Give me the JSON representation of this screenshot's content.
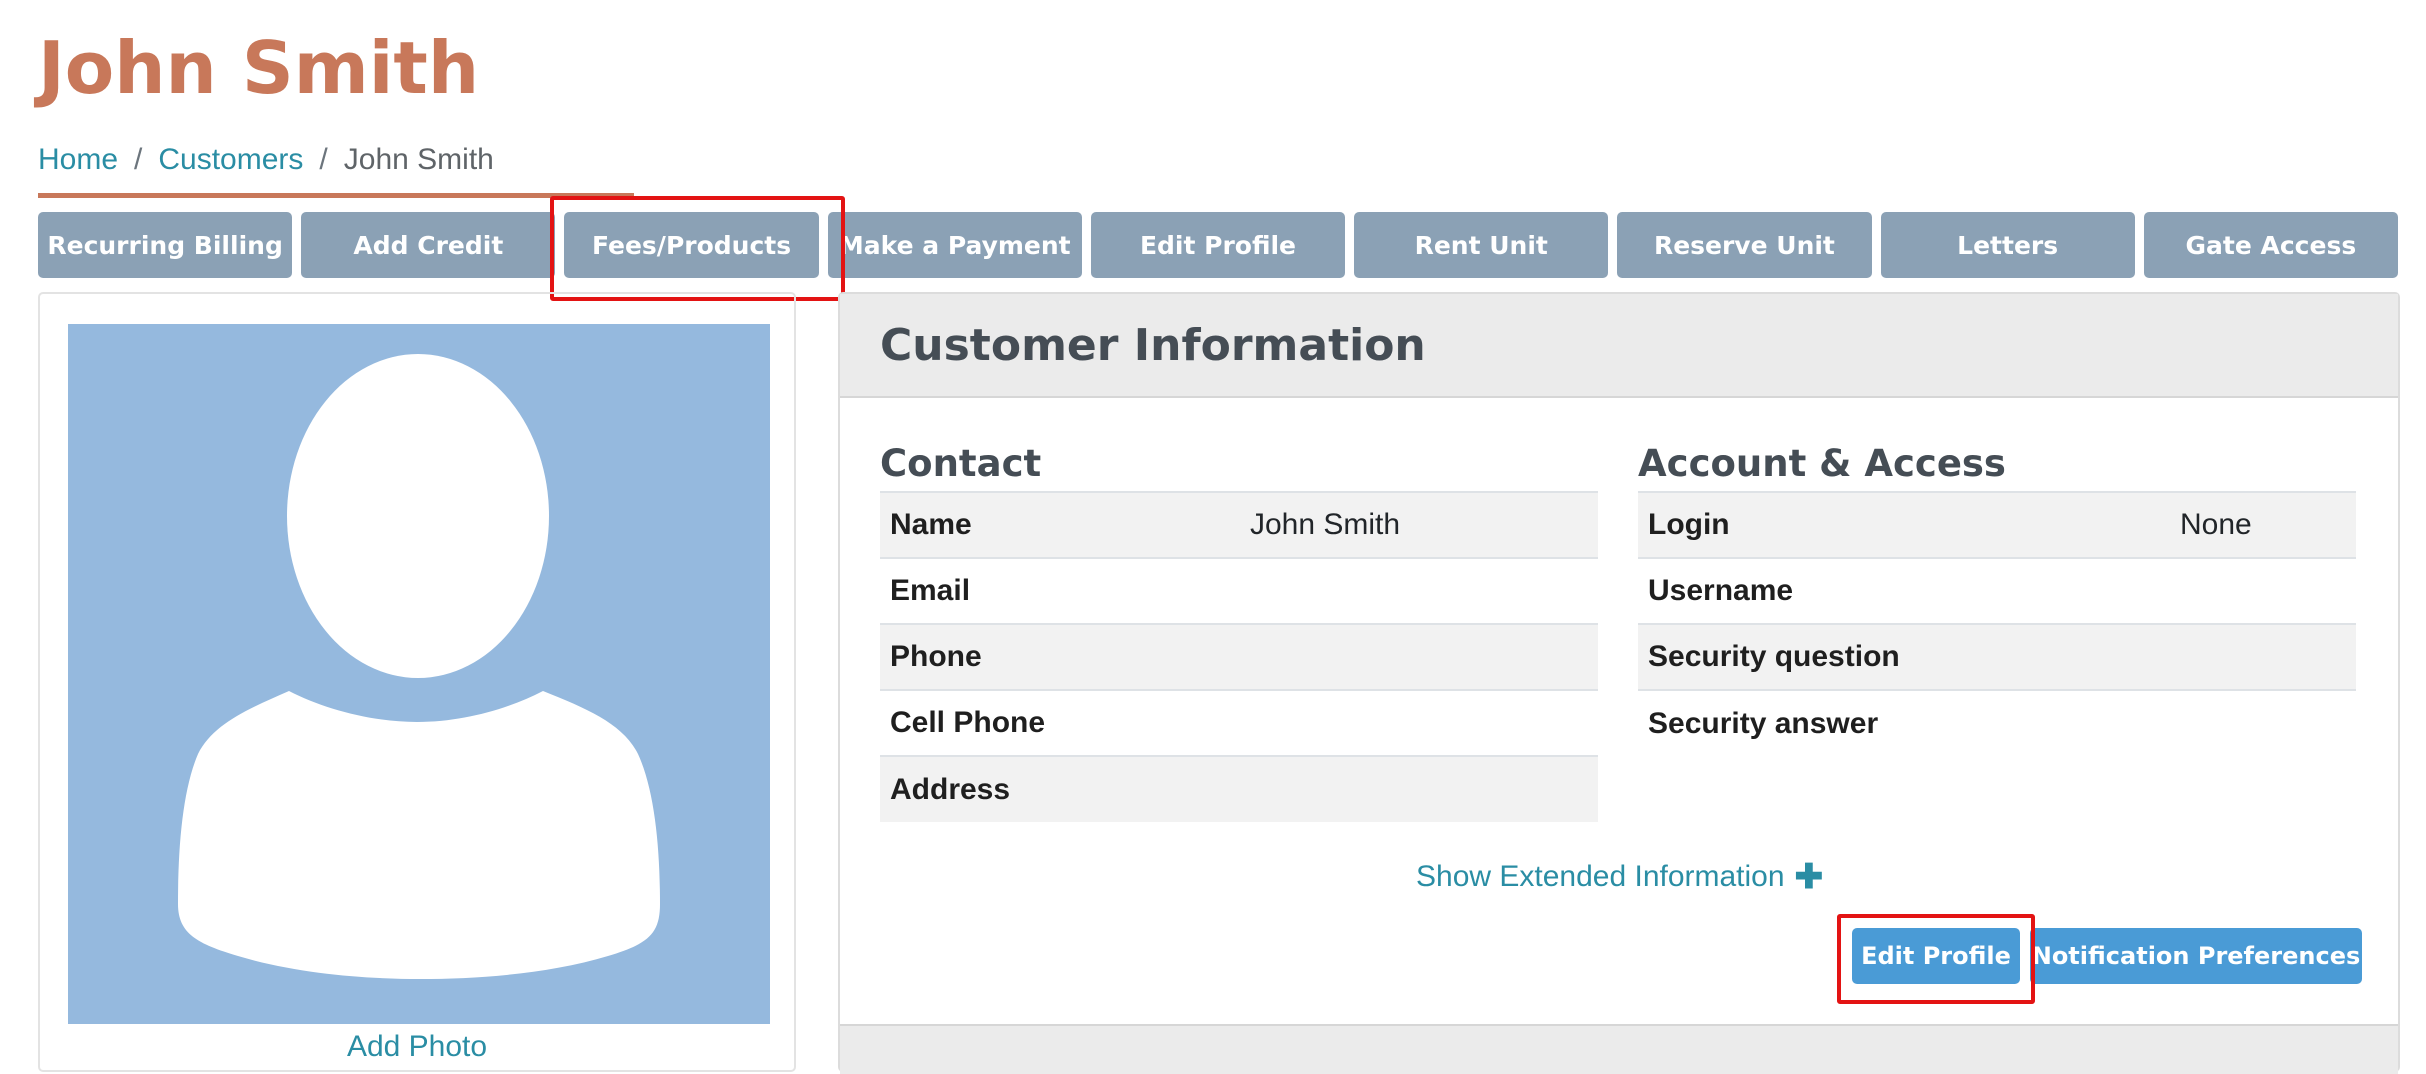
{
  "page_title": "John Smith",
  "breadcrumb": {
    "home": "Home",
    "separator": "/",
    "customers": "Customers",
    "current": "John Smith"
  },
  "actions": [
    "Recurring Billing",
    "Add Credit",
    "Fees/Products",
    "Make a Payment",
    "Edit Profile",
    "Rent Unit",
    "Reserve Unit",
    "Letters",
    "Gate Access"
  ],
  "photo": {
    "add_photo_label": "Add Photo",
    "avatar_icon": "person-silhouette-icon"
  },
  "customer_info": {
    "title": "Customer Information",
    "contact": {
      "heading": "Contact",
      "rows": [
        {
          "label": "Name",
          "value": "John Smith"
        },
        {
          "label": "Email",
          "value": ""
        },
        {
          "label": "Phone",
          "value": ""
        },
        {
          "label": "Cell Phone",
          "value": ""
        },
        {
          "label": "Address",
          "value": ""
        }
      ]
    },
    "account": {
      "heading": "Account & Access",
      "rows": [
        {
          "label": "Login",
          "value": "None"
        },
        {
          "label": "Username",
          "value": ""
        },
        {
          "label": "Security question",
          "value": ""
        },
        {
          "label": "Security answer",
          "value": ""
        }
      ]
    },
    "show_extended_label": "Show Extended Information",
    "show_extended_icon": "plus-icon",
    "edit_profile_label": "Edit Profile",
    "notification_prefs_label": "Notification Preferences"
  },
  "colors": {
    "title": "#c8785a",
    "link": "#2a8da4",
    "action_button": "#8ba1b5",
    "primary_button": "#4a9bd6",
    "highlight": "#e31313",
    "avatar_background": "#95b9de"
  }
}
